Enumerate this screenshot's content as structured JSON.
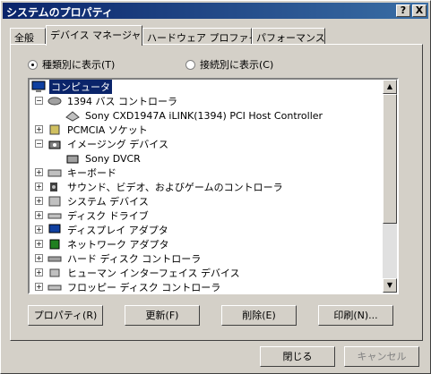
{
  "window": {
    "title": "システムのプロパティ",
    "help": "?",
    "close": "X"
  },
  "tabs": [
    {
      "label": "全般"
    },
    {
      "label": "デバイス マネージャ"
    },
    {
      "label": "ハードウェア プロファイル"
    },
    {
      "label": "パフォーマンス"
    }
  ],
  "view": {
    "by_type": "種類別に表示(T)",
    "by_connection": "接続別に表示(C)",
    "selected": "by_type"
  },
  "tree": {
    "items": [
      {
        "label": "コンピュータ",
        "icon": "computer-icon"
      },
      {
        "label": "1394 バス コントローラ",
        "icon": "bus-icon"
      },
      {
        "label": "Sony CXD1947A iLINK(1394) PCI Host Controller",
        "icon": "controller-icon"
      },
      {
        "label": "PCMCIA ソケット",
        "icon": "pcmcia-icon"
      },
      {
        "label": "イメージング デバイス",
        "icon": "camera-icon"
      },
      {
        "label": "Sony DVCR",
        "icon": "camera-device-icon"
      },
      {
        "label": "キーボード",
        "icon": "keyboard-icon"
      },
      {
        "label": "サウンド、ビデオ、およびゲームのコントローラ",
        "icon": "sound-icon"
      },
      {
        "label": "システム デバイス",
        "icon": "system-icon"
      },
      {
        "label": "ディスク ドライブ",
        "icon": "disk-icon"
      },
      {
        "label": "ディスプレイ アダプタ",
        "icon": "display-icon"
      },
      {
        "label": "ネットワーク アダプタ",
        "icon": "network-icon"
      },
      {
        "label": "ハード ディスク コントローラ",
        "icon": "hdd-controller-icon"
      },
      {
        "label": "ヒューマン インターフェイス デバイス",
        "icon": "hid-icon"
      },
      {
        "label": "フロッピー ディスク コントローラ",
        "icon": "floppy-icon"
      }
    ]
  },
  "buttons": {
    "properties": "プロパティ(R)",
    "refresh": "更新(F)",
    "remove": "削除(E)",
    "print": "印刷(N)...",
    "close": "閉じる",
    "cancel": "キャンセル"
  },
  "colors": {
    "titlebar": "#0a246a",
    "selection": "#0a246a",
    "face": "#d4d0c8"
  }
}
